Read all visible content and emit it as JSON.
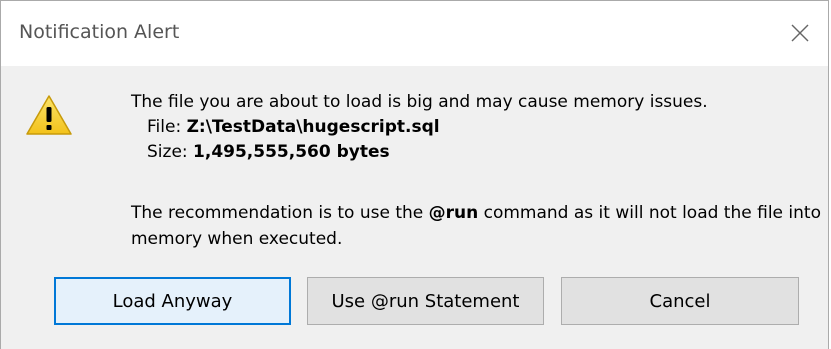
{
  "window": {
    "title": "Notification Alert",
    "close_glyph": "✕"
  },
  "message": {
    "intro": "The file you are about to load is big and may cause memory issues.",
    "file_label": "File:",
    "file_value": "Z:\\TestData\\hugescript.sql",
    "size_label": "Size:",
    "size_value": "1,495,555,560 bytes",
    "reco_before": "The recommendation is to use the ",
    "reco_command": "@run",
    "reco_after": " command as it will not load the file into memory when executed."
  },
  "buttons": {
    "load_anyway": "Load Anyway",
    "use_run": "Use @run Statement",
    "cancel": "Cancel"
  },
  "icons": {
    "warning": "warning-icon",
    "close": "close-icon"
  },
  "colors": {
    "warning_fill": "#f7d23c",
    "default_button_border": "#0078d7"
  }
}
